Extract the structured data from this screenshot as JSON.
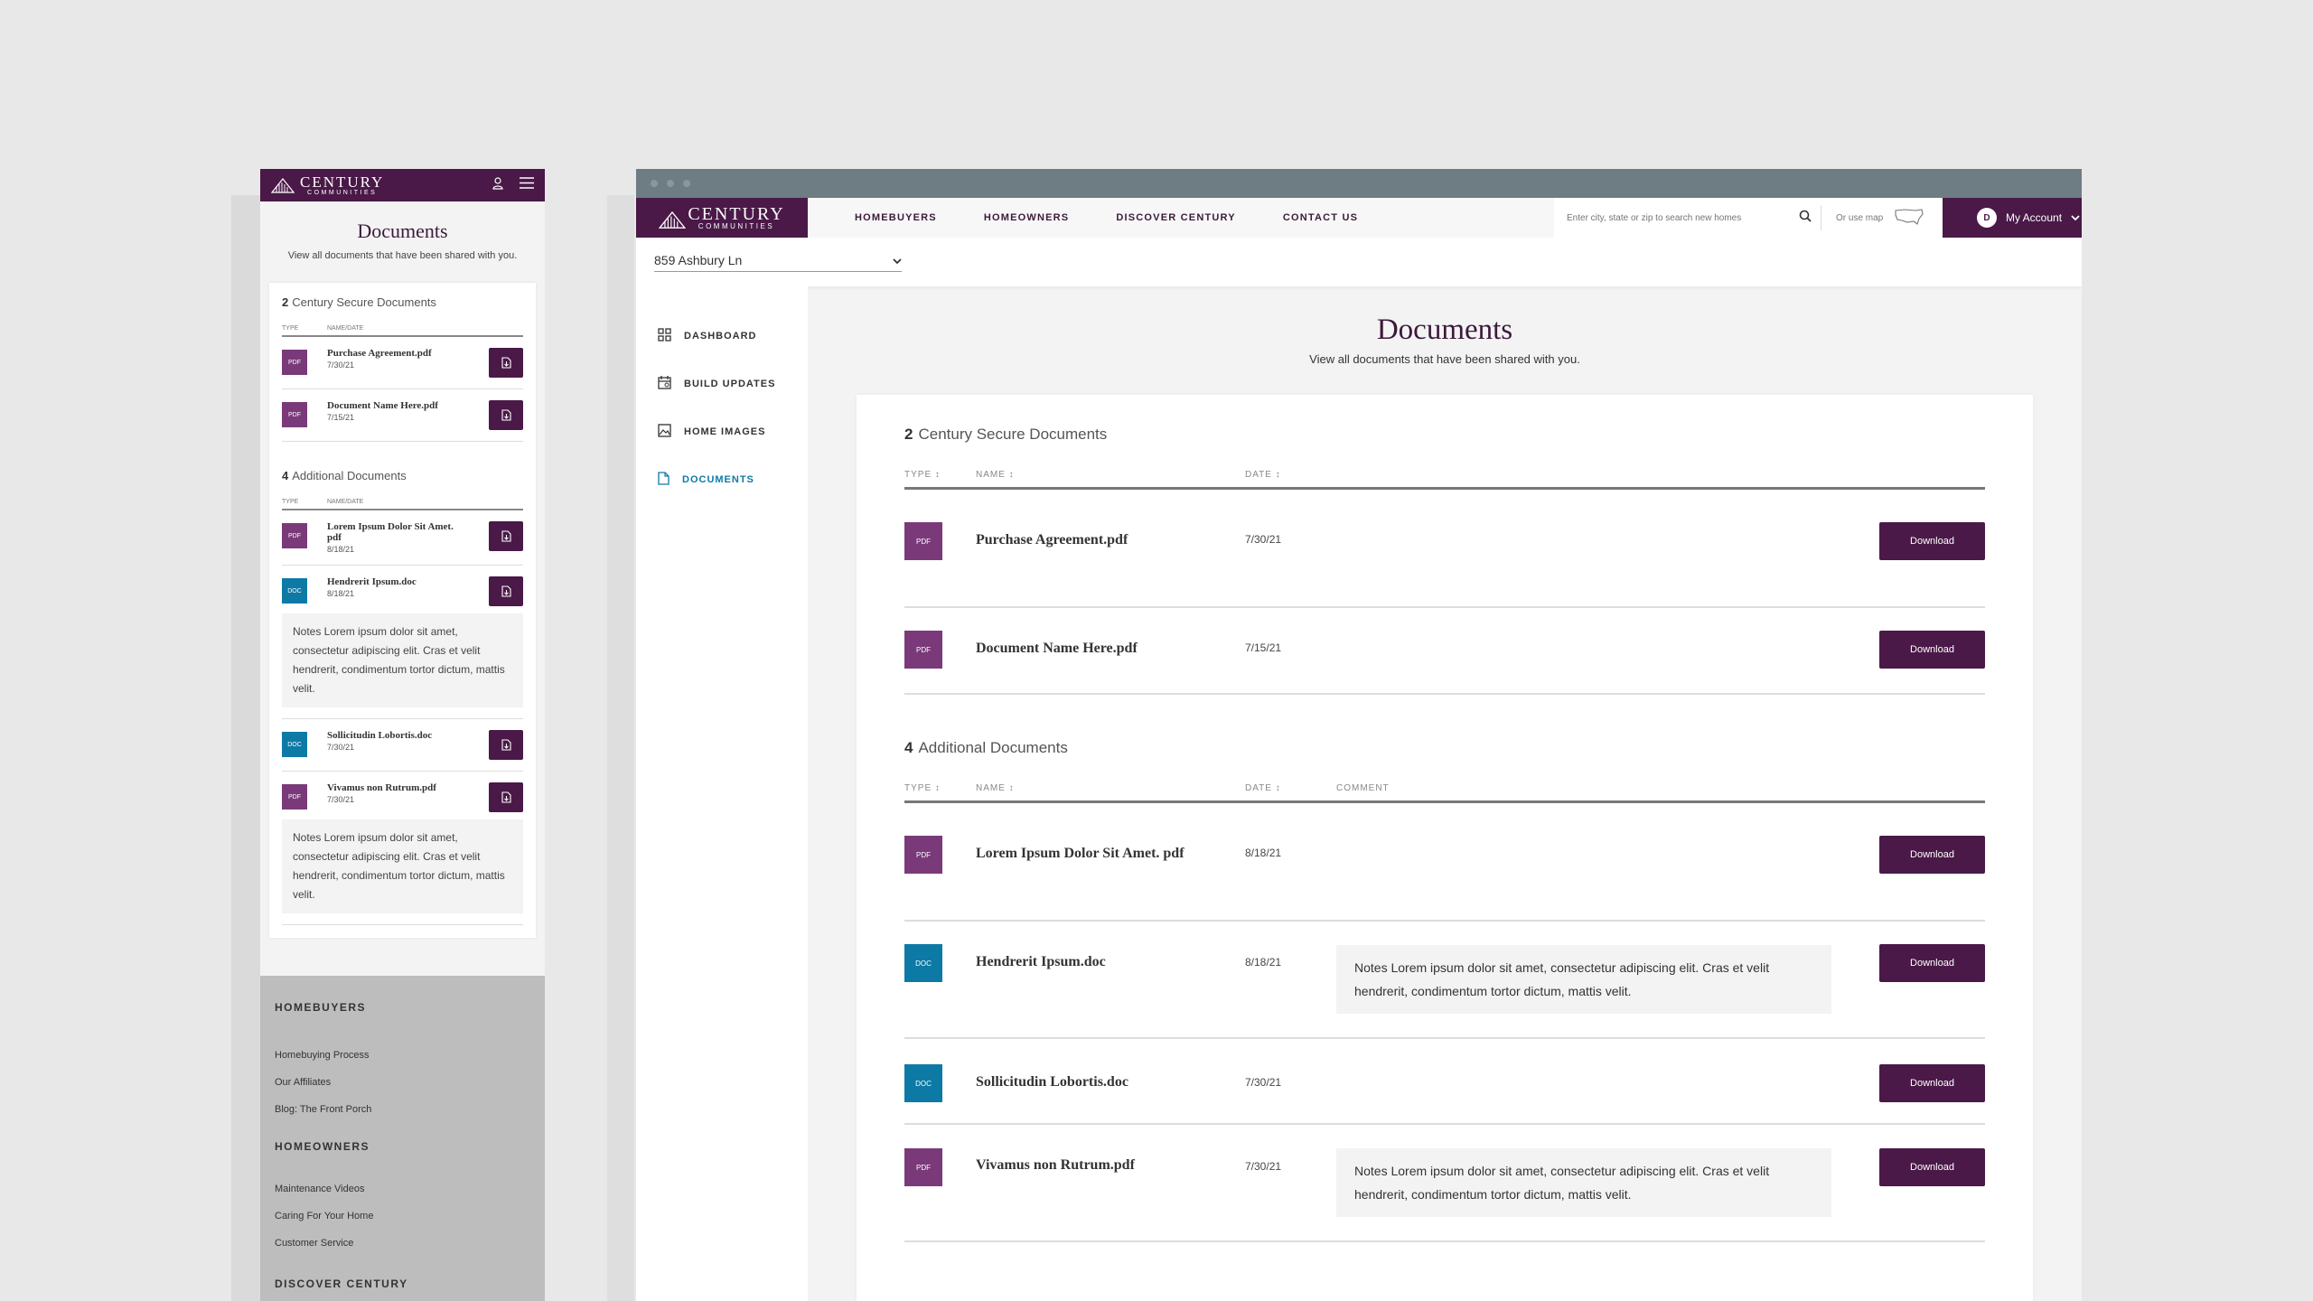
{
  "brand": {
    "logo_big": "CENTURY",
    "logo_small": "COMMUNITIES",
    "purple": "#4a1948",
    "pdf_color": "#7a3a7a",
    "doc_color": "#0d7aa6",
    "active_color": "#0d7aa6"
  },
  "page": {
    "title": "Documents",
    "subtitle": "View all documents that have been shared with you."
  },
  "mobile": {
    "secure": {
      "count": "2",
      "title": "Century Secure Documents",
      "col_type": "TYPE",
      "col_namedate": "NAME/DATE",
      "rows": [
        {
          "type": "PDF",
          "name": "Purchase Agreement.pdf",
          "date": "7/30/21"
        },
        {
          "type": "PDF",
          "name": "Document Name Here.pdf",
          "date": "7/15/21"
        }
      ]
    },
    "additional": {
      "count": "4",
      "title": "Additional Documents",
      "col_type": "TYPE",
      "col_namedate": "NAME/DATE",
      "rows": [
        {
          "type": "PDF",
          "name": "Lorem Ipsum Dolor Sit Amet. pdf",
          "date": "8/18/21"
        },
        {
          "type": "DOC",
          "name": "Hendrerit Ipsum.doc",
          "date": "8/18/21",
          "note": "Notes Lorem ipsum dolor sit amet, consectetur adipiscing elit. Cras et velit hendrerit, condimentum tortor dictum, mattis velit."
        },
        {
          "type": "DOC",
          "name": "Sollicitudin Lobortis.doc",
          "date": "7/30/21"
        },
        {
          "type": "PDF",
          "name": "Vivamus non Rutrum.pdf",
          "date": "7/30/21",
          "note": "Notes Lorem ipsum dolor sit amet, consectetur adipiscing elit. Cras et velit hendrerit, condimentum tortor dictum, mattis velit."
        }
      ]
    },
    "footer": {
      "homebuyers": {
        "heading": "HOMEBUYERS",
        "links": [
          "Homebuying Process",
          "Our Affiliates",
          "Blog: The Front Porch"
        ]
      },
      "homeowners": {
        "heading": "HOMEOWNERS",
        "links": [
          "Maintenance Videos",
          "Caring For Your Home",
          "Customer Service"
        ]
      },
      "discover": {
        "heading": "DISCOVER CENTURY"
      }
    }
  },
  "desktop": {
    "nav": {
      "links": [
        "HOMEBUYERS",
        "HOMEOWNERS",
        "DISCOVER CENTURY",
        "CONTACT US"
      ],
      "search_placeholder": "Enter city, state or zip to search new homes",
      "map_label": "Or use map",
      "account_initial": "D",
      "account_label": "My Account"
    },
    "address": "859 Ashbury Ln",
    "sidebar": [
      {
        "label": "DASHBOARD",
        "icon": "dashboard-icon"
      },
      {
        "label": "BUILD UPDATES",
        "icon": "calendar-icon"
      },
      {
        "label": "HOME IMAGES",
        "icon": "image-icon"
      },
      {
        "label": "DOCUMENTS",
        "icon": "document-icon",
        "active": true
      }
    ],
    "secure": {
      "count": "2",
      "title": "Century Secure Documents",
      "col_type": "TYPE",
      "col_name": "NAME",
      "col_date": "DATE",
      "rows": [
        {
          "type": "PDF",
          "name": "Purchase Agreement.pdf",
          "date": "7/30/21"
        },
        {
          "type": "PDF",
          "name": "Document Name Here.pdf",
          "date": "7/15/21"
        }
      ]
    },
    "additional": {
      "count": "4",
      "title": "Additional Documents",
      "col_type": "TYPE",
      "col_name": "NAME",
      "col_date": "DATE",
      "col_comment": "COMMENT",
      "rows": [
        {
          "type": "PDF",
          "name": "Lorem Ipsum Dolor Sit Amet. pdf",
          "date": "8/18/21"
        },
        {
          "type": "DOC",
          "name": "Hendrerit Ipsum.doc",
          "date": "8/18/21",
          "comment": "Notes Lorem ipsum dolor sit amet, consectetur adipiscing elit. Cras et velit hendrerit, condimentum tortor dictum, mattis velit."
        },
        {
          "type": "DOC",
          "name": "Sollicitudin Lobortis.doc",
          "date": "7/30/21"
        },
        {
          "type": "PDF",
          "name": "Vivamus non Rutrum.pdf",
          "date": "7/30/21",
          "comment": "Notes Lorem ipsum dolor sit amet, consectetur adipiscing elit. Cras et velit hendrerit, condimentum tortor dictum, mattis velit."
        }
      ]
    },
    "download_label": "Download"
  }
}
